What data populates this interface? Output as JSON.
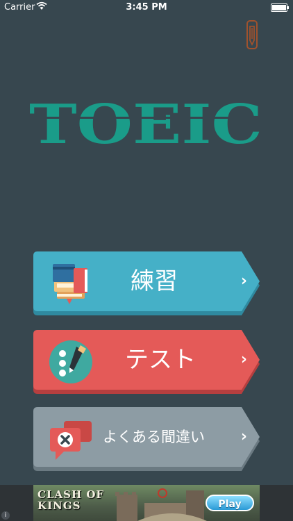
{
  "status_bar": {
    "carrier": "Carrier",
    "time": "3:45 PM"
  },
  "logo": {
    "text": "TOEIC",
    "color": "#1a9c89"
  },
  "menu": {
    "practice": {
      "label": "練習",
      "color": "#45b0c7",
      "shadow": "#2f8aa0",
      "icon": "books-icon"
    },
    "test": {
      "label": "テスト",
      "color": "#e45a58",
      "shadow": "#b63f3f",
      "icon": "pen-checklist-icon"
    },
    "mistakes": {
      "label": "よくある間違い",
      "color": "#8d9ca4",
      "shadow": "#6b7a82",
      "icon": "error-chat-icon"
    },
    "chevron": "›"
  },
  "ad": {
    "title_line1": "CLASH OF",
    "title_line2": "KINGS",
    "play_label": "Play",
    "info_label": "i"
  }
}
